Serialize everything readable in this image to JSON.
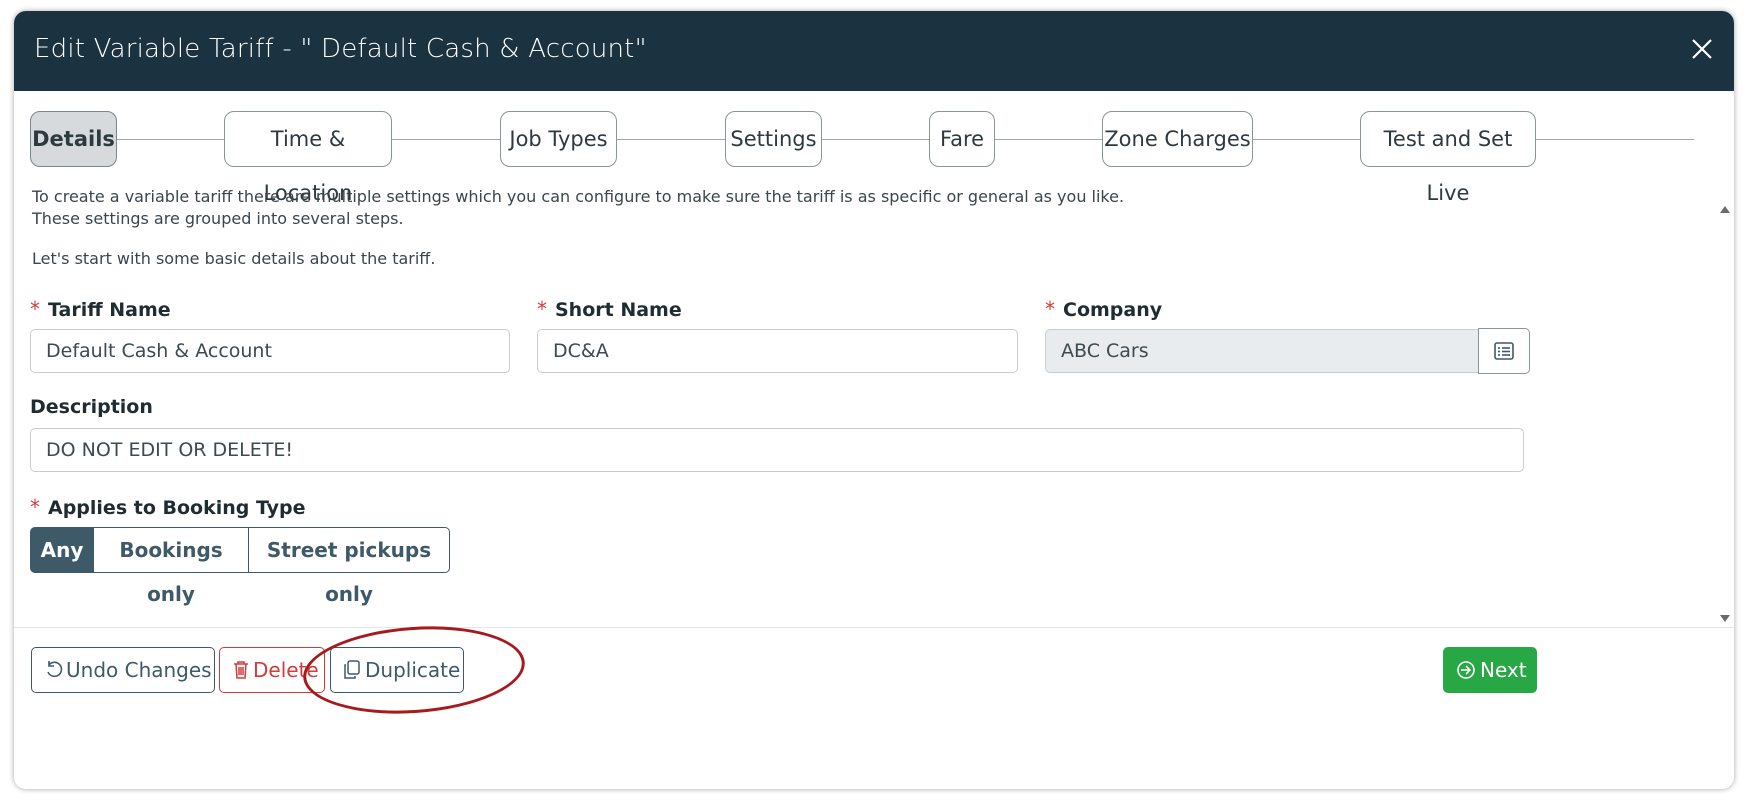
{
  "header": {
    "title": "Edit Variable Tariff - \" Default Cash & Account\""
  },
  "steps": [
    {
      "label": "Details"
    },
    {
      "label": "Time & Location"
    },
    {
      "label": "Job Types"
    },
    {
      "label": "Settings"
    },
    {
      "label": "Fare"
    },
    {
      "label": "Zone Charges"
    },
    {
      "label": "Test and Set Live"
    }
  ],
  "intro": {
    "line1": "To create a variable tariff there are multiple settings which you can configure to make sure the tariff is as specific or general as you like.",
    "line2": "These settings are grouped into several steps.",
    "line3": "Let's start with some basic details about the tariff."
  },
  "form": {
    "tariff_name": {
      "label": "Tariff Name",
      "value": "Default Cash & Account"
    },
    "short_name": {
      "label": "Short Name",
      "value": "DC&A"
    },
    "company": {
      "label": "Company",
      "value": "ABC Cars"
    },
    "description": {
      "label": "Description",
      "value": "DO NOT EDIT OR DELETE!"
    },
    "booking_type": {
      "label": "Applies to Booking Type",
      "options": [
        "Any",
        "Bookings only",
        "Street pickups only"
      ],
      "selected": "Any"
    },
    "required_marker": "*"
  },
  "footer": {
    "undo_label": "Undo Changes",
    "delete_label": "Delete",
    "duplicate_label": "Duplicate",
    "next_label": "Next"
  },
  "colors": {
    "header_bg": "#1b3340",
    "accent": "#3e5a68",
    "danger": "#d23b3b",
    "success": "#27a844",
    "annotation": "#a8191c"
  }
}
